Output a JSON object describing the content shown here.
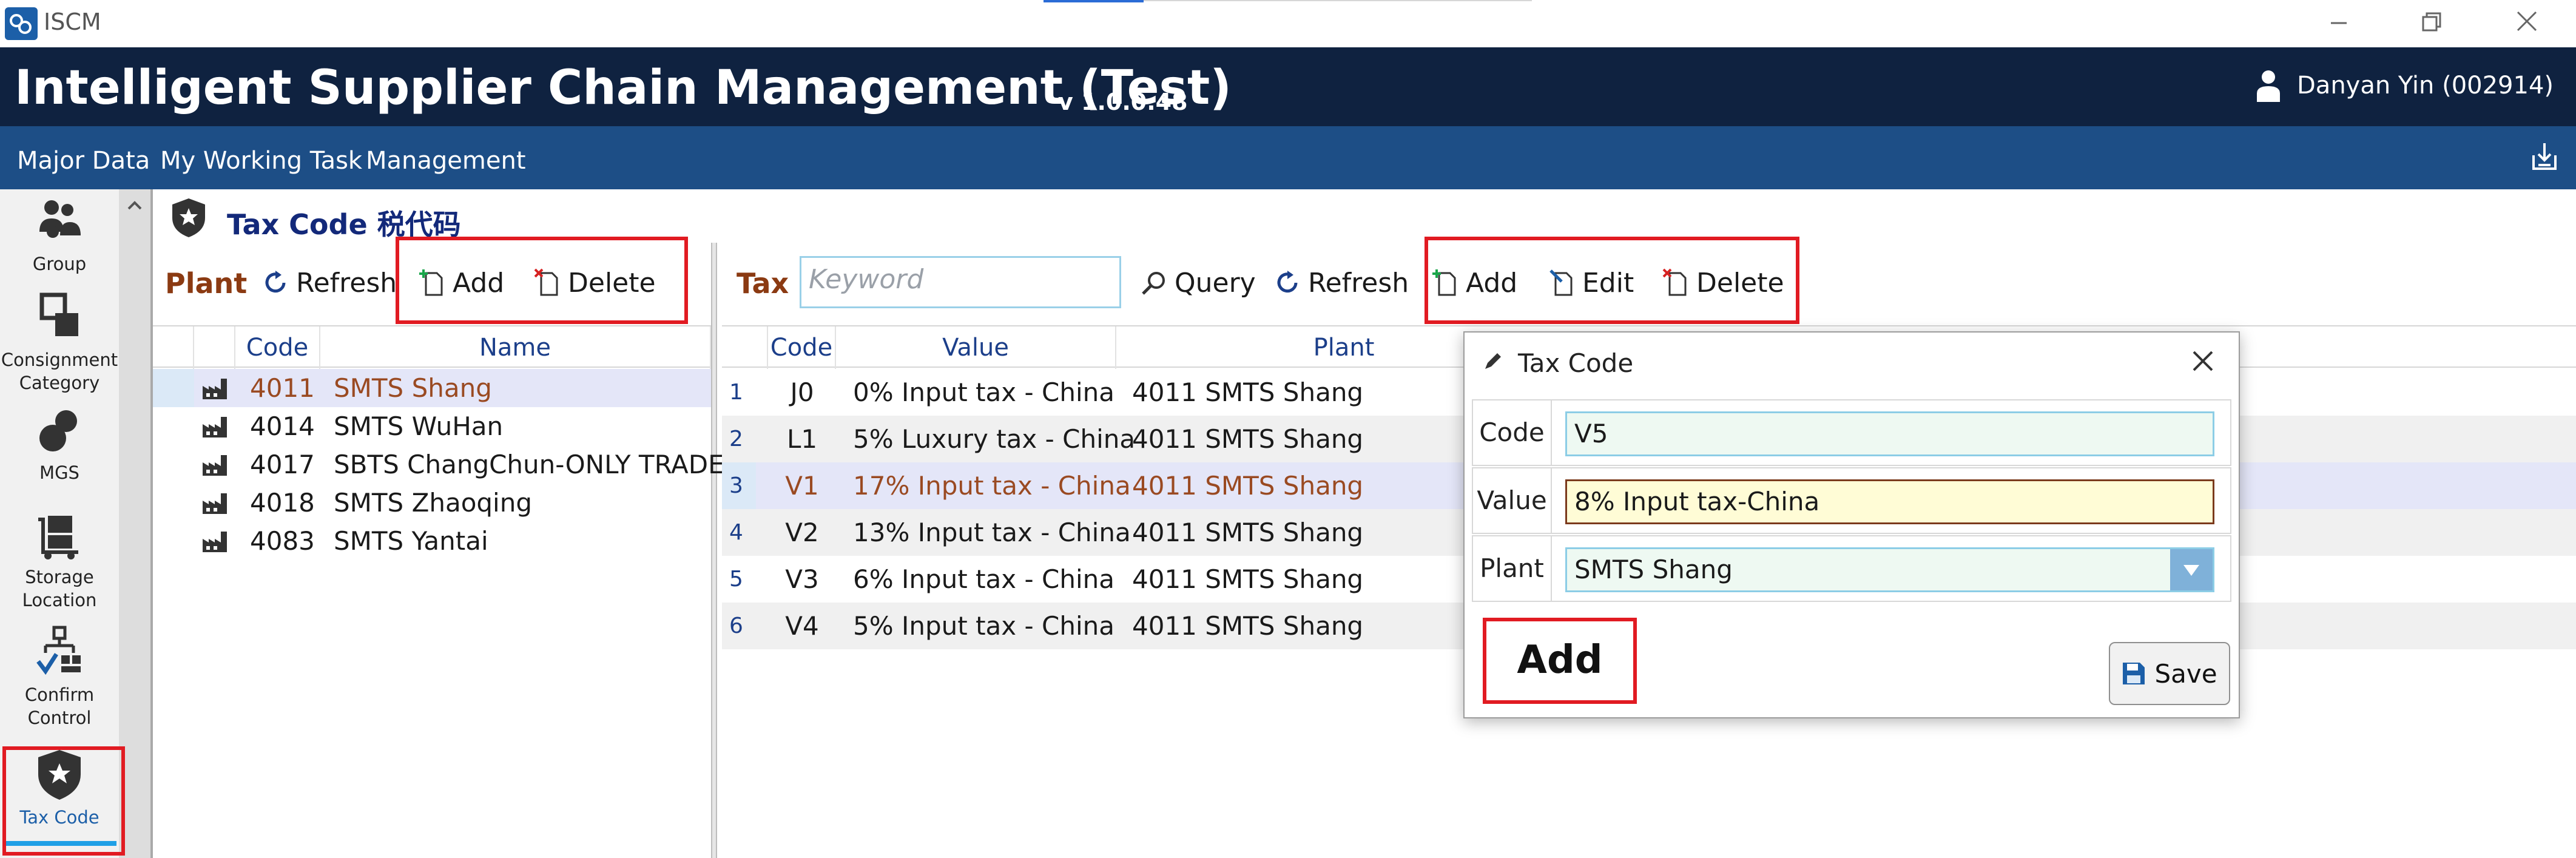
{
  "window": {
    "app_name": "ISCM"
  },
  "header": {
    "title": "Intelligent Supplier Chain Management (Test)",
    "version": "v 1.0.0.48",
    "user": "Danyan Yin (002914)"
  },
  "menu": {
    "items": [
      "Major Data",
      "My Working Task",
      "Management"
    ]
  },
  "nav": {
    "items": [
      {
        "label": "Group",
        "icon": "group-icon"
      },
      {
        "label_line1": "Consignment",
        "label_line2": "Category",
        "icon": "consignment-icon"
      },
      {
        "label": "MGS",
        "icon": "mgs-icon"
      },
      {
        "label_line1": "Storage",
        "label_line2": "Location",
        "icon": "storage-icon"
      },
      {
        "label_line1": "Confirm",
        "label_line2": "Control",
        "icon": "confirm-control-icon"
      },
      {
        "label": "Tax Code",
        "icon": "tax-code-icon",
        "selected": true
      }
    ]
  },
  "page": {
    "title": "Tax Code 税代码"
  },
  "plant_panel": {
    "label": "Plant",
    "refresh": "Refresh",
    "add": "Add",
    "delete": "Delete",
    "columns": [
      "Code",
      "Name"
    ],
    "rows": [
      {
        "code": "4011",
        "name": "SMTS Shang",
        "selected": true
      },
      {
        "code": "4014",
        "name": "SMTS WuHan"
      },
      {
        "code": "4017",
        "name": "SBTS ChangChun-ONLY TRADE"
      },
      {
        "code": "4018",
        "name": "SMTS Zhaoqing"
      },
      {
        "code": "4083",
        "name": "SMTS Yantai"
      }
    ]
  },
  "tax_panel": {
    "label": "Tax",
    "keyword_placeholder": "Keyword",
    "query": "Query",
    "refresh": "Refresh",
    "add": "Add",
    "edit": "Edit",
    "delete": "Delete",
    "columns": [
      "Code",
      "Value",
      "Plant"
    ],
    "rows": [
      {
        "num": "1",
        "code": "J0",
        "value": "0% Input tax - China",
        "plant": "4011 SMTS Shang"
      },
      {
        "num": "2",
        "code": "L1",
        "value": "5% Luxury tax - China",
        "plant": "4011 SMTS Shang"
      },
      {
        "num": "3",
        "code": "V1",
        "value": "17% Input tax - China",
        "plant": "4011 SMTS Shang",
        "selected": true
      },
      {
        "num": "4",
        "code": "V2",
        "value": "13% Input tax - China",
        "plant": "4011 SMTS Shang"
      },
      {
        "num": "5",
        "code": "V3",
        "value": "6% Input tax - China",
        "plant": "4011 SMTS Shang"
      },
      {
        "num": "6",
        "code": "V4",
        "value": "5% Input tax - China",
        "plant": "4011 SMTS Shang"
      }
    ]
  },
  "dialog": {
    "title": "Tax Code",
    "code_label": "Code",
    "code_value": "V5",
    "value_label": "Value",
    "value_value": "8% Input tax-China",
    "plant_label": "Plant",
    "plant_value": "SMTS Shang",
    "mode": "Add",
    "save": "Save"
  },
  "colors": {
    "header_bg": "#0f2240",
    "menu_bg": "#1d4e86",
    "highlight_box": "#e11b22",
    "selected_text": "#9a4a22",
    "title_text": "#13297a"
  }
}
